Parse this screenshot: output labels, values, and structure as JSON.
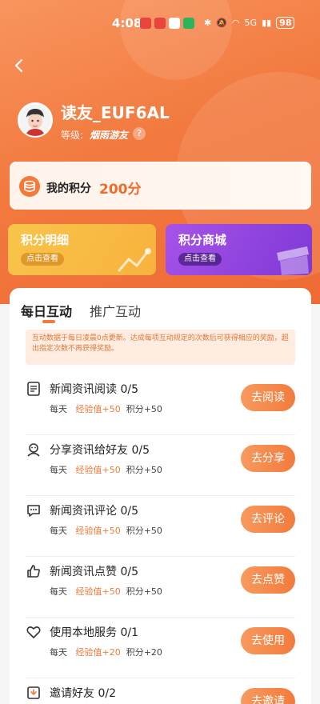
{
  "status_bar": {
    "time": "4:08",
    "battery": "98",
    "network": "5G"
  },
  "user": {
    "name": "读友_EUF6AL",
    "level_label": "等级:",
    "level_name": "烟雨游友",
    "help_icon": "?"
  },
  "points": {
    "label": "我的积分",
    "value": "200分"
  },
  "tiles": [
    {
      "title": "积分明细",
      "button": "点击查看"
    },
    {
      "title": "积分商城",
      "button": "点击查看"
    }
  ],
  "tabs": [
    {
      "label": "每日互动",
      "active": true
    },
    {
      "label": "推广互动",
      "active": false
    }
  ],
  "notice": "互动数据于每日凌晨0点更新。达成每项互动规定的次数后可获得相应的奖励，超出指定次数不再获得奖励。",
  "tasks": [
    {
      "icon": "article-icon",
      "title": "新闻资讯阅读 0/5",
      "freq": "每天",
      "exp": "经验值+50",
      "points": "积分+50",
      "button": "去阅读"
    },
    {
      "icon": "share-user-icon",
      "title": "分享资讯给好友 0/5",
      "freq": "每天",
      "exp": "经验值+50",
      "points": "积分+50",
      "button": "去分享"
    },
    {
      "icon": "comment-icon",
      "title": "新闻资讯评论 0/5",
      "freq": "每天",
      "exp": "经验值+50",
      "points": "积分+50",
      "button": "去评论"
    },
    {
      "icon": "thumbs-up-icon",
      "title": "新闻资讯点赞 0/5",
      "freq": "每天",
      "exp": "经验值+50",
      "points": "积分+50",
      "button": "去点赞"
    },
    {
      "icon": "heart-icon",
      "title": "使用本地服务 0/1",
      "freq": "每天",
      "exp": "经验值+20",
      "points": "积分+20",
      "button": "去使用"
    },
    {
      "icon": "invite-icon",
      "title": "邀请好友 0/2",
      "freq": "",
      "exp": "",
      "points": "",
      "button": "去邀请"
    }
  ],
  "colors": {
    "brand": "#f27a3f",
    "accent_text": "#f06a2a",
    "button_gradient_start": "#f79a5e",
    "button_gradient_end": "#f27b3d",
    "tile_left": "#f7b23c",
    "tile_right": "#7f38d6"
  }
}
